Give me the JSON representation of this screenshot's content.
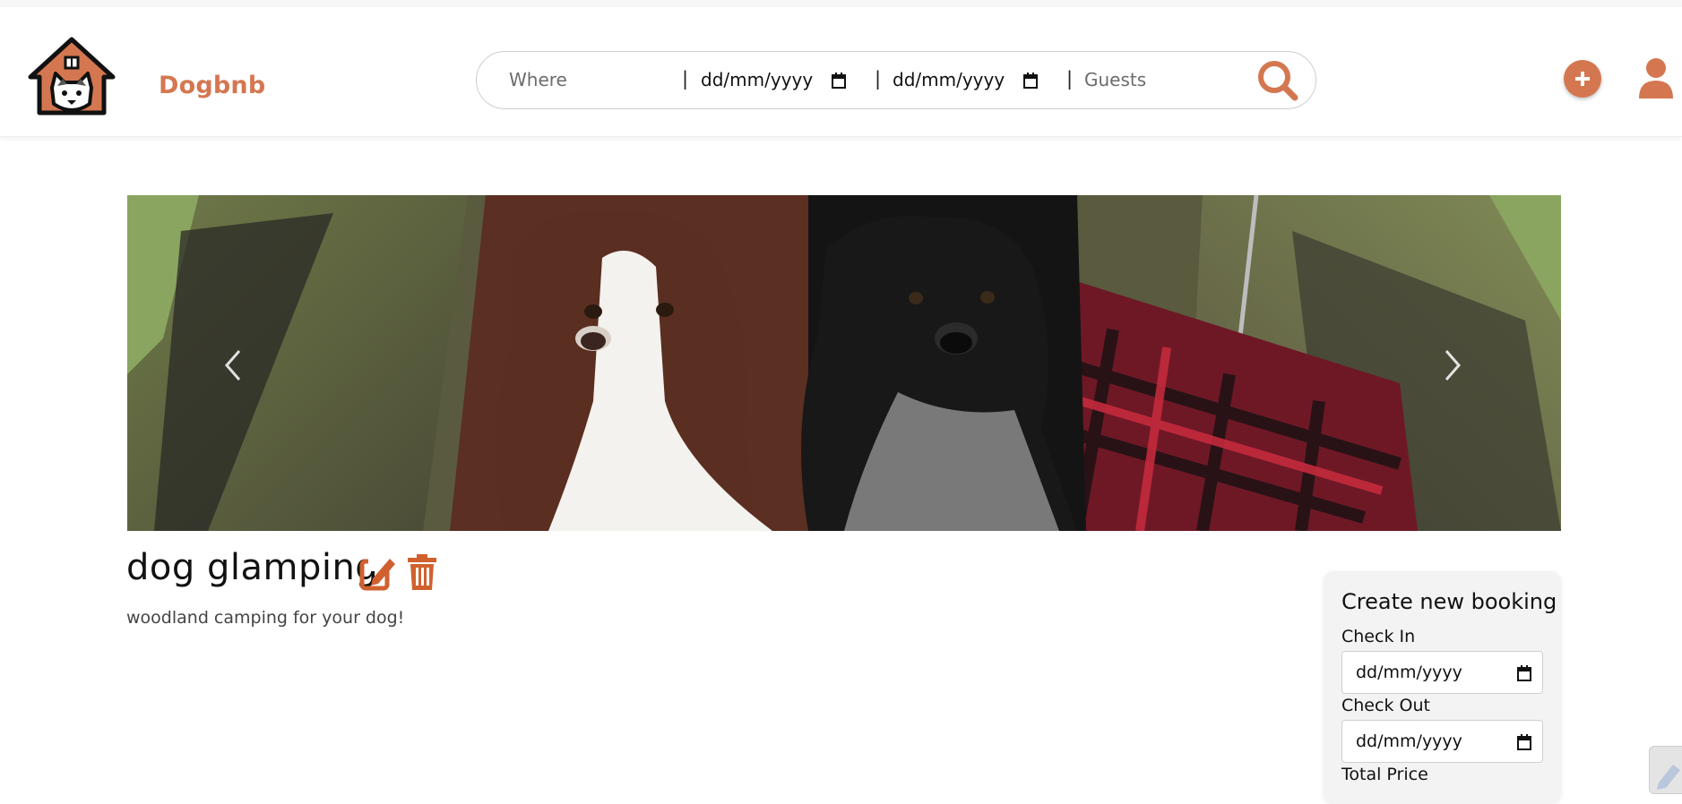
{
  "app": {
    "brand": "Dogbnb",
    "accent_color": "#d47750"
  },
  "search": {
    "where_placeholder": "Where",
    "separator": "|",
    "checkin_value": "dd/mm/yyyy",
    "checkout_value": "dd/mm/yyyy",
    "guests_placeholder": "Guests",
    "search_icon": "search-icon"
  },
  "header_actions": {
    "add_icon": "plus-circle-icon",
    "user_icon": "user-icon"
  },
  "carousel": {
    "image": "two-dogs-in-tent-photo",
    "prev_icon": "chevron-left-icon",
    "next_icon": "chevron-right-icon"
  },
  "listing": {
    "title": "dog glamping",
    "description": "woodland camping for your dog!",
    "edit_icon": "edit-icon",
    "delete_icon": "trash-icon"
  },
  "booking": {
    "title": "Create new booking",
    "checkin_label": "Check In",
    "checkin_value": "dd/mm/yyyy",
    "checkout_label": "Check Out",
    "checkout_value": "dd/mm/yyyy",
    "total_label": "Total Price"
  }
}
